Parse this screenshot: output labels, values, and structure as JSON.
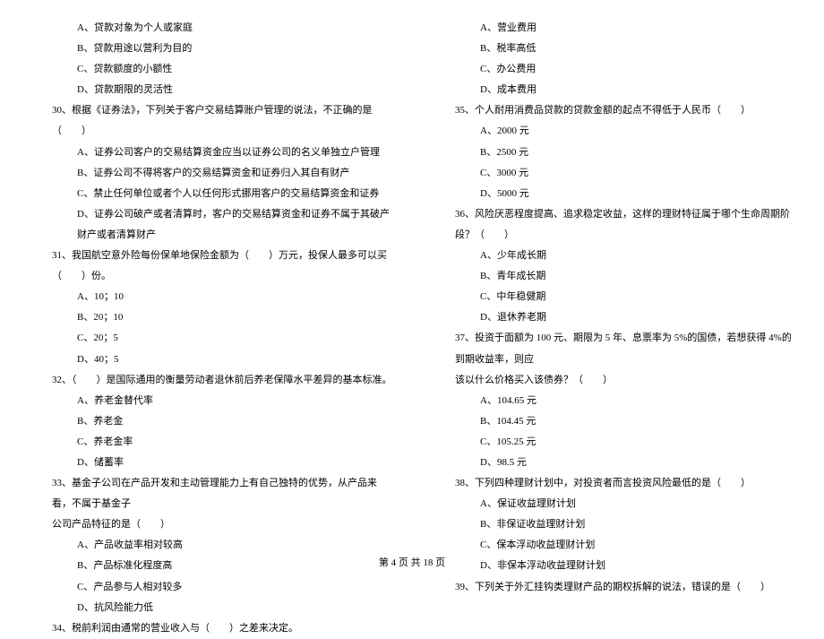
{
  "left": {
    "q29": {
      "opts": {
        "a": "A、贷款对象为个人或家庭",
        "b": "B、贷款用途以营利为目的",
        "c": "C、贷款额度的小额性",
        "d": "D、贷款期限的灵活性"
      }
    },
    "q30": {
      "stem": "30、根据《证券法》，下列关于客户交易结算账户管理的说法，不正确的是（　　）",
      "opts": {
        "a": "A、证券公司客户的交易结算资金应当以证券公司的名义单独立户管理",
        "b": "B、证券公司不得将客户的交易结算资金和证券归入其自有财产",
        "c": "C、禁止任何单位或者个人以任何形式挪用客户的交易结算资金和证券",
        "d": "D、证券公司破产或者清算时，客户的交易结算资金和证券不属于其破产财产或者清算财产"
      }
    },
    "q31": {
      "stem": "31、我国航空意外险每份保单地保险金额为（　　）万元，投保人最多可以买（　　）份。",
      "opts": {
        "a": "A、10；10",
        "b": "B、20；10",
        "c": "C、20；5",
        "d": "D、40；5"
      }
    },
    "q32": {
      "stem": "32、（　　）是国际通用的衡量劳动者退休前后养老保障水平差异的基本标准。",
      "opts": {
        "a": "A、养老金替代率",
        "b": "B、养老金",
        "c": "C、养老金率",
        "d": "D、储蓄率"
      }
    },
    "q33": {
      "stem1": "33、基金子公司在产品开发和主动管理能力上有自己独特的优势，从产品来看，不属于基金子",
      "stem2": "公司产品特征的是（　　）",
      "opts": {
        "a": "A、产品收益率相对较高",
        "b": "B、产品标准化程度高",
        "c": "C、产品参与人相对较多",
        "d": "D、抗风险能力低"
      }
    },
    "q34": {
      "stem": "34、税前利润由通常的营业收入与（　　）之差来决定。"
    }
  },
  "right": {
    "q34": {
      "opts": {
        "a": "A、营业费用",
        "b": "B、税率高低",
        "c": "C、办公费用",
        "d": "D、成本费用"
      }
    },
    "q35": {
      "stem": "35、个人耐用消费品贷款的贷款金额的起点不得低于人民币（　　）",
      "opts": {
        "a": "A、2000 元",
        "b": "B、2500 元",
        "c": "C、3000 元",
        "d": "D、5000 元"
      }
    },
    "q36": {
      "stem": "36、风险厌恶程度提高、追求稳定收益，这样的理财特征属于哪个生命周期阶段？（　　）",
      "opts": {
        "a": "A、少年成长期",
        "b": "B、青年成长期",
        "c": "C、中年稳健期",
        "d": "D、退休养老期"
      }
    },
    "q37": {
      "stem1": "37、投资于面额为 100 元、期限为 5 年、息票率为 5%的国债，若想获得 4%的到期收益率，则应",
      "stem2": "该以什么价格买入该债券？（　　）",
      "opts": {
        "a": "A、104.65 元",
        "b": "B、104.45 元",
        "c": "C、105.25 元",
        "d": "D、98.5 元"
      }
    },
    "q38": {
      "stem": "38、下列四种理财计划中，对投资者而言投资风险最低的是（　　）",
      "opts": {
        "a": "A、保证收益理财计划",
        "b": "B、非保证收益理财计划",
        "c": "C、保本浮动收益理财计划",
        "d": "D、非保本浮动收益理财计划"
      }
    },
    "q39": {
      "stem": "39、下列关于外汇挂钩类理财产品的期权拆解的说法，错误的是（　　）"
    }
  },
  "footer": "第 4 页 共 18 页"
}
